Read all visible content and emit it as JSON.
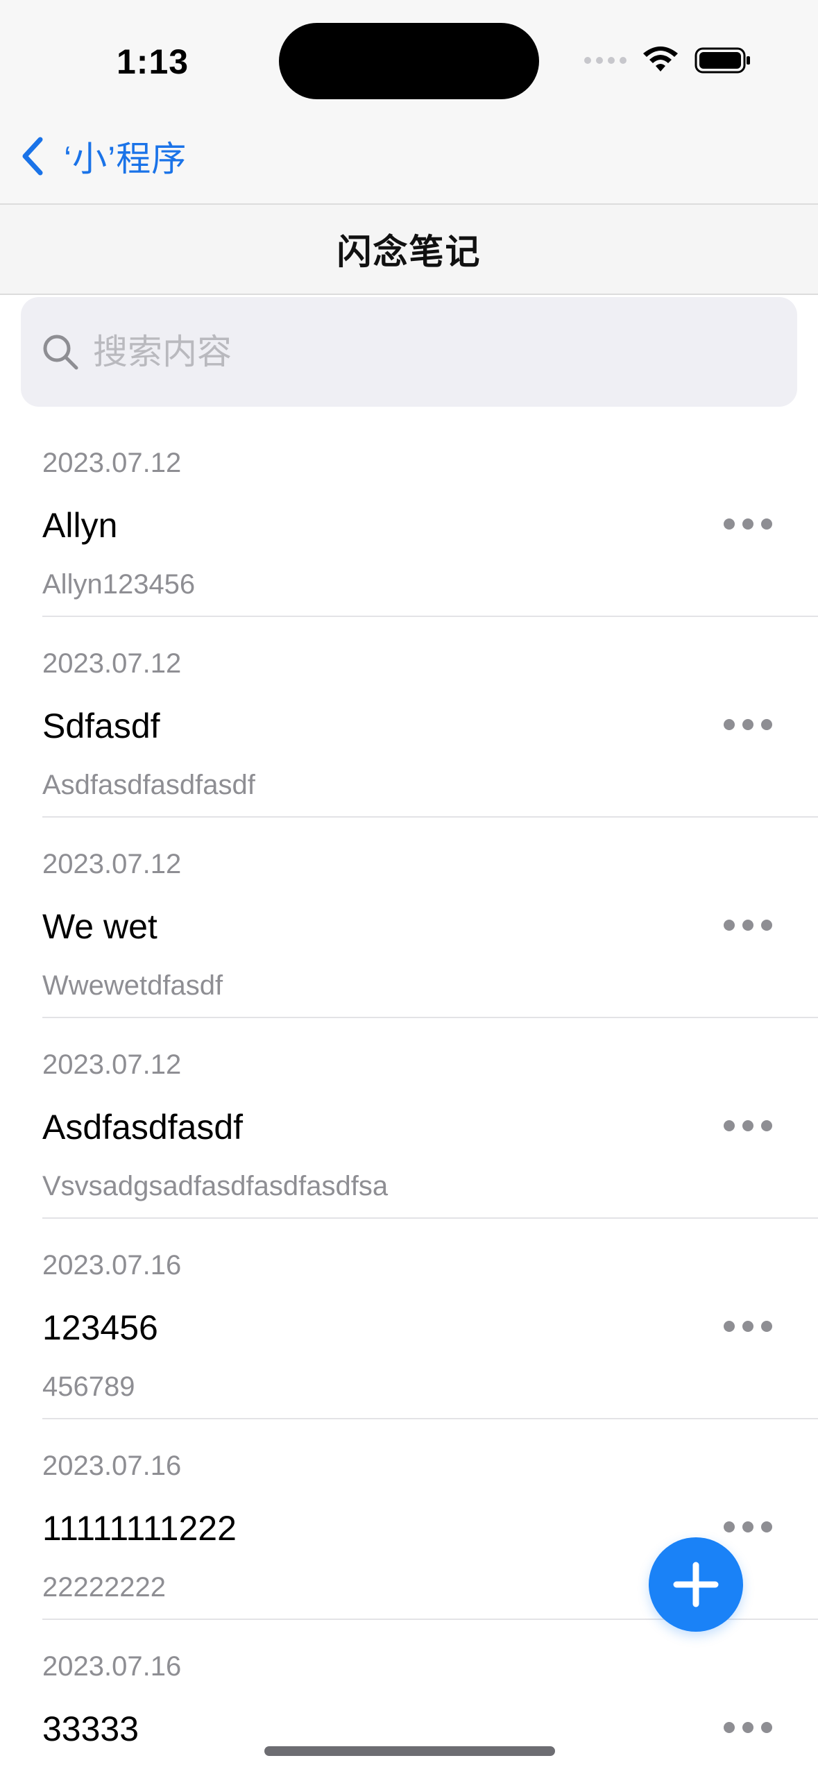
{
  "status_bar": {
    "time": "1:13"
  },
  "nav": {
    "back_label": "‘小’程序",
    "title": "闪念笔记"
  },
  "search": {
    "placeholder": "搜索内容",
    "value": ""
  },
  "notes": [
    {
      "date": "2023.07.12",
      "title": "Allyn",
      "body": "Allyn123456"
    },
    {
      "date": "2023.07.12",
      "title": "Sdfasdf",
      "body": "Asdfasdfasdfasdf"
    },
    {
      "date": "2023.07.12",
      "title": "We wet",
      "body": "Wwewetdfasdf"
    },
    {
      "date": "2023.07.12",
      "title": "Asdfasdfasdf",
      "body": "Vsvsadgsadfasdfasdfasdfsa"
    },
    {
      "date": "2023.07.16",
      "title": "123456",
      "body": "456789"
    },
    {
      "date": "2023.07.16",
      "title": "11111111222",
      "body": "22222222"
    },
    {
      "date": "2023.07.16",
      "title": "33333",
      "body": ""
    }
  ],
  "icons": {
    "back": "chevron-left-icon",
    "search": "search-icon",
    "more": "more-horizontal-icon",
    "add": "plus-icon",
    "wifi": "wifi-icon",
    "battery": "battery-icon"
  },
  "colors": {
    "accent": "#1a82f7",
    "link": "#1a73e8",
    "secondary_text": "#8e8e93"
  }
}
